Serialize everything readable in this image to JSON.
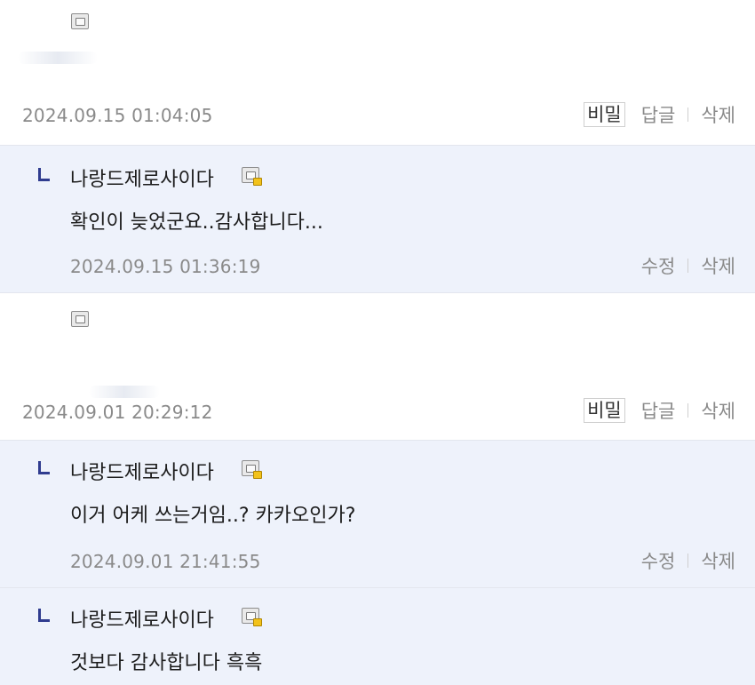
{
  "comments": [
    {
      "kind": "comment",
      "date": "2024.09.15 01:04:05",
      "actions": {
        "secret": "비밀",
        "reply": "답글",
        "delete": "삭제"
      }
    },
    {
      "kind": "reply",
      "author": "나랑드제로사이다",
      "text": "확인이 늦었군요..감사합니다...",
      "date": "2024.09.15 01:36:19",
      "actions": {
        "edit": "수정",
        "delete": "삭제"
      }
    },
    {
      "kind": "comment",
      "date": "2024.09.01 20:29:12",
      "actions": {
        "secret": "비밀",
        "reply": "답글",
        "delete": "삭제"
      }
    },
    {
      "kind": "reply",
      "author": "나랑드제로사이다",
      "text": "이거 어케 쓰는거임..? 카카오인가?",
      "date": "2024.09.01 21:41:55",
      "actions": {
        "edit": "수정",
        "delete": "삭제"
      }
    },
    {
      "kind": "reply",
      "author": "나랑드제로사이다",
      "text": "것보다 감사합니다 흑흑"
    }
  ],
  "colors": {
    "reply_background": "#eef2fb",
    "reply_marker": "#2f3c8f",
    "meta_text": "#8a8a8a"
  },
  "icons": {
    "avatar_icon": "profile-card-icon",
    "author_badge": "profile-card-lock-icon"
  }
}
